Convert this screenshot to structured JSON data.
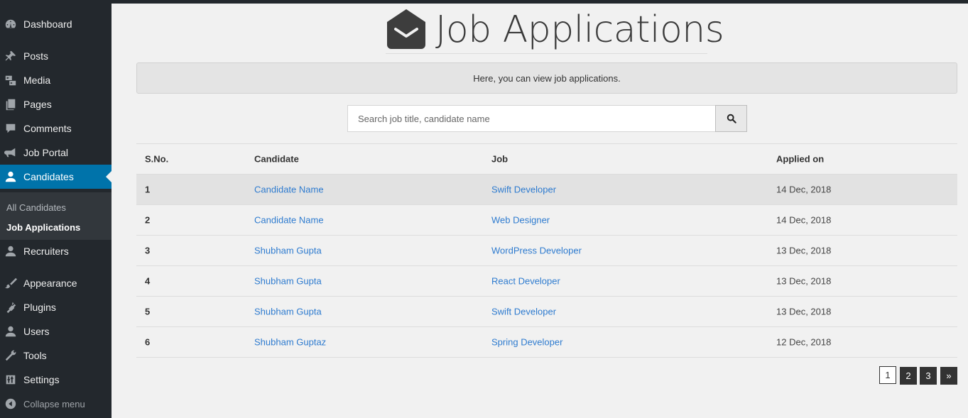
{
  "sidebar": {
    "items": [
      {
        "label": "Dashboard",
        "icon": "dashboard-icon"
      },
      {
        "label": "Posts",
        "icon": "pin-icon"
      },
      {
        "label": "Media",
        "icon": "media-icon"
      },
      {
        "label": "Pages",
        "icon": "pages-icon"
      },
      {
        "label": "Comments",
        "icon": "comment-icon"
      },
      {
        "label": "Job Portal",
        "icon": "megaphone-icon"
      },
      {
        "label": "Candidates",
        "icon": "user-icon"
      },
      {
        "label": "Recruiters",
        "icon": "user-icon"
      },
      {
        "label": "Appearance",
        "icon": "brush-icon"
      },
      {
        "label": "Plugins",
        "icon": "plugin-icon"
      },
      {
        "label": "Users",
        "icon": "user-icon"
      },
      {
        "label": "Tools",
        "icon": "wrench-icon"
      },
      {
        "label": "Settings",
        "icon": "settings-icon"
      }
    ],
    "submenu": [
      "All Candidates",
      "Job Applications"
    ],
    "collapse_label": "Collapse menu",
    "active_color": "#0073aa"
  },
  "page": {
    "title": "Job Applications",
    "notice": "Here, you can view job applications."
  },
  "search": {
    "placeholder": "Search job title, candidate name"
  },
  "table": {
    "headers": [
      "S.No.",
      "Candidate",
      "Job",
      "Applied on"
    ],
    "rows": [
      {
        "sno": "1",
        "candidate": "Candidate Name",
        "job": "Swift Developer",
        "date": "14 Dec, 2018"
      },
      {
        "sno": "2",
        "candidate": "Candidate Name",
        "job": "Web Designer",
        "date": "14 Dec, 2018"
      },
      {
        "sno": "3",
        "candidate": "Shubham Gupta",
        "job": "WordPress Developer",
        "date": "13 Dec, 2018"
      },
      {
        "sno": "4",
        "candidate": "Shubham Gupta",
        "job": "React Developer",
        "date": "13 Dec, 2018"
      },
      {
        "sno": "5",
        "candidate": "Shubham Gupta",
        "job": "Swift Developer",
        "date": "13 Dec, 2018"
      },
      {
        "sno": "6",
        "candidate": "Shubham Guptaz",
        "job": "Spring Developer",
        "date": "12 Dec, 2018"
      }
    ]
  },
  "pagination": {
    "pages": [
      "1",
      "2",
      "3",
      "»"
    ],
    "current": "1"
  }
}
